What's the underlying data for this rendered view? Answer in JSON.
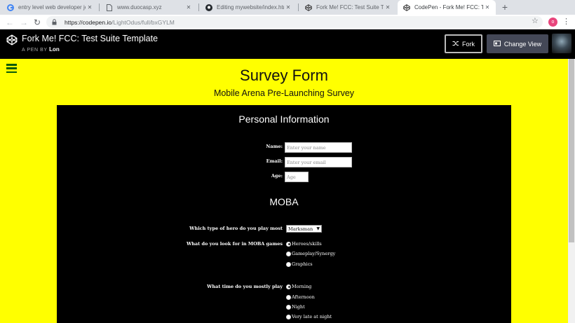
{
  "browser": {
    "tabs": [
      {
        "title": "entry level web developer jobs -",
        "icon": "google-icon"
      },
      {
        "title": "www.duocasp.xyz",
        "icon": "page-icon"
      },
      {
        "title": "Editing mywebsite/index.html at",
        "icon": "github-icon"
      },
      {
        "title": "Fork Me! FCC: Test Suite Temp",
        "icon": "codepen-icon"
      },
      {
        "title": "CodePen - Fork Me! FCC: Test S",
        "icon": "codepen-icon",
        "active": true
      }
    ],
    "new_tab": "+",
    "window_controls": {
      "minimize": "—",
      "maximize": "☐",
      "close": "✕"
    },
    "url_host": "https://codepen.io",
    "url_path": "/LightOdus/full/bxGYLM",
    "profile_initial": "o"
  },
  "codepen": {
    "title": "Fork Me! FCC: Test Suite Template",
    "sub_prefix": "A PEN BY",
    "author": "Lon",
    "fork_label": "Fork",
    "change_view_label": "Change View"
  },
  "survey": {
    "title": "Survey Form",
    "description": "Mobile Arena Pre-Launching Survey",
    "personal": {
      "heading": "Personal Information",
      "name_label": "Name:",
      "name_placeholder": "Enter your name",
      "email_label": "Email:",
      "email_placeholder": "Enter your email",
      "age_label": "Age:",
      "age_placeholder": "Age"
    },
    "moba": {
      "heading": "MOBA",
      "hero_label": "Which type of hero do you play most",
      "hero_selected": "Marksman",
      "look_label": "What do you look for in MOBA games",
      "look_options": [
        "Heroes/skills",
        "Gameplay/Synergy",
        "Graphics"
      ],
      "time_label": "What time do you mostly play",
      "time_options": [
        "Morning",
        "Afternoon",
        "Night",
        "Very late at night"
      ]
    }
  },
  "colors": {
    "page_bg": "#ffff00",
    "panel_bg": "#000000",
    "hamburger": "#0a5c0a",
    "header_bg": "#000000",
    "change_view_bg": "#444857"
  }
}
